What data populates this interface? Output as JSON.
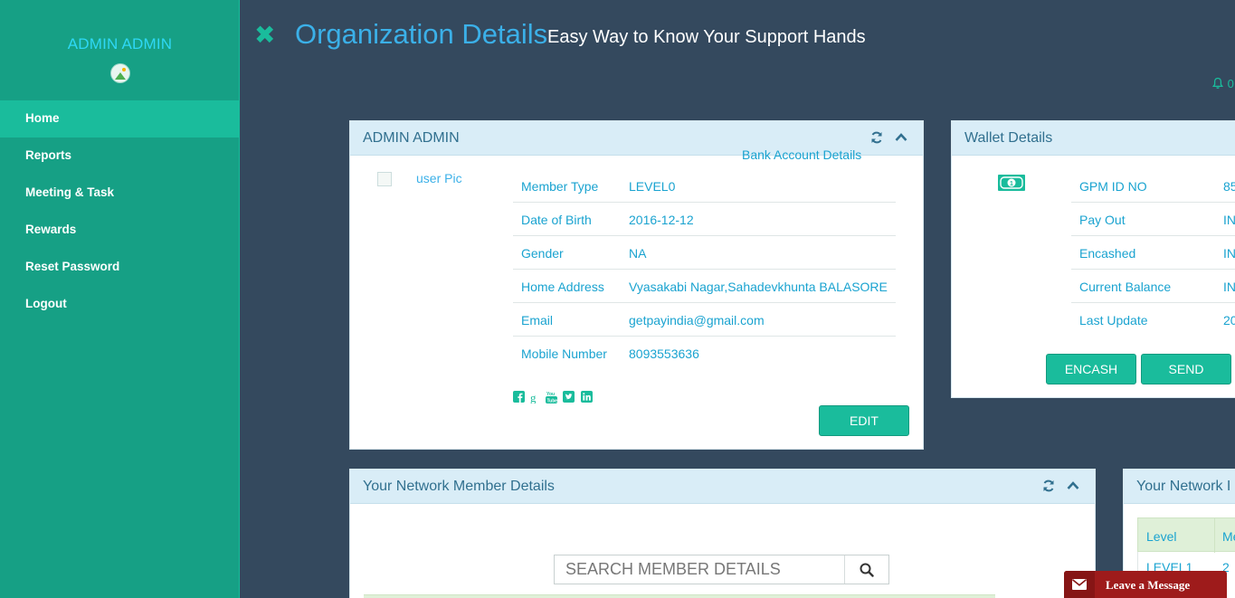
{
  "sidebar": {
    "user_name": "ADMIN ADMIN",
    "items": [
      {
        "label": "Home",
        "active": true
      },
      {
        "label": "Reports"
      },
      {
        "label": "Meeting & Task"
      },
      {
        "label": "Rewards"
      },
      {
        "label": "Reset Password"
      },
      {
        "label": "Logout"
      }
    ]
  },
  "header": {
    "title": "Organization Details",
    "subtitle": "Easy Way to Know Your Support Hands",
    "notification_count": "0"
  },
  "profile_panel": {
    "title": "ADMIN ADMIN",
    "user_pic_alt": "user Pic",
    "bank_link": "Bank Account Details",
    "rows": [
      {
        "label": "Member Type",
        "value": "LEVEL0"
      },
      {
        "label": "Date of Birth",
        "value": "2016-12-12"
      },
      {
        "label": "Gender",
        "value": "NA"
      },
      {
        "label": "Home Address",
        "value": "Vyasakabi Nagar,Sahadevkhunta BALASORE"
      },
      {
        "label": "Email",
        "value": "getpayindia@gmail.com"
      },
      {
        "label": "Mobile Number",
        "value": "8093553636"
      }
    ],
    "social_icons": [
      "facebook-icon",
      "google-plus-icon",
      "youtube-icon",
      "twitter-icon",
      "linkedin-icon"
    ],
    "edit_label": "EDIT"
  },
  "wallet_panel": {
    "title": "Wallet Details",
    "rows": [
      {
        "label": "GPM ID NO",
        "value": "85"
      },
      {
        "label": "Pay Out",
        "value": "IN"
      },
      {
        "label": "Encashed",
        "value": "IN"
      },
      {
        "label": "Current Balance",
        "value": "IN"
      },
      {
        "label": "Last Update",
        "value": "20"
      }
    ],
    "encash_label": "ENCASH",
    "send_label": "SEND"
  },
  "network_member_panel": {
    "title": "Your Network Member Details",
    "search_placeholder": "SEARCH MEMBER DETAILS"
  },
  "network_level_panel": {
    "title": "Your Network I",
    "headers": [
      "Level",
      "Me"
    ],
    "rows": [
      {
        "level": "LEVEL1",
        "count": "2"
      }
    ]
  },
  "chat": {
    "label": "Leave a Message"
  },
  "colors": {
    "sidebar": "#16a085",
    "accent": "#1abc9c",
    "background": "#34495e",
    "panel_head": "#d9edf7",
    "text_blue": "#1aa3d0",
    "chat": "#9e1b1b"
  }
}
